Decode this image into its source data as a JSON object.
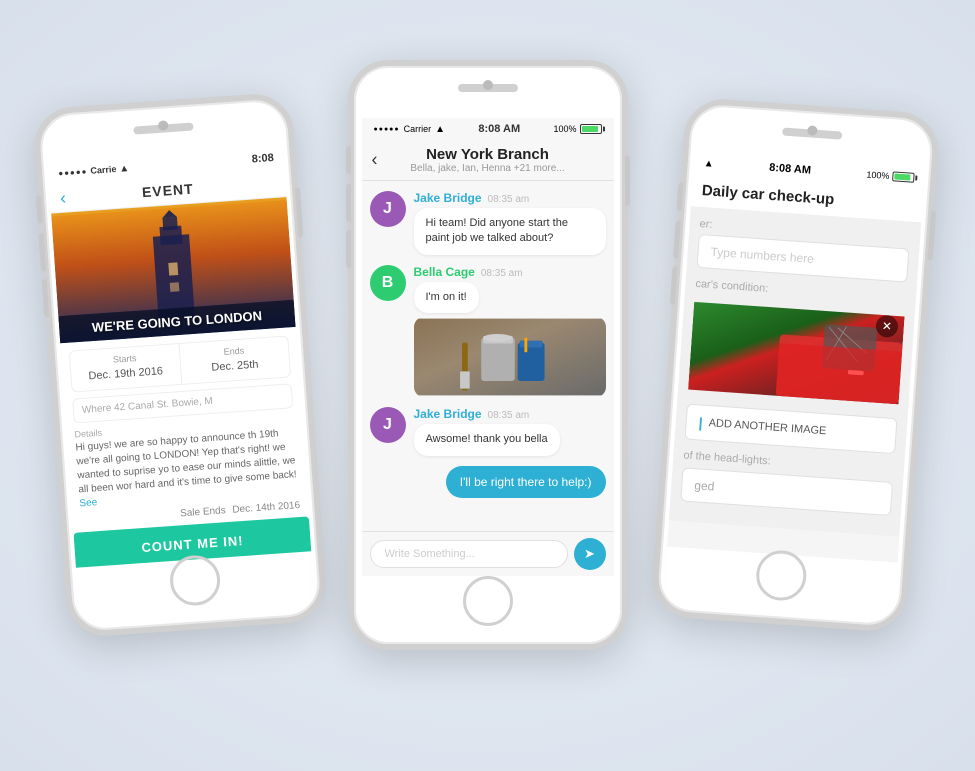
{
  "left_phone": {
    "status_bar": {
      "carrier": "Carrie",
      "signal": "●●●●●",
      "wifi": "wifi",
      "time": "8:08"
    },
    "header": {
      "back_label": "‹",
      "title": "EVENT"
    },
    "hero_text": "WE'RE GOING TO LONDON",
    "dates": {
      "starts_label": "Starts",
      "starts_value": "Dec. 19th 2016",
      "ends_label": "Ends",
      "ends_value": "Dec. 25th"
    },
    "where_label": "Where",
    "where_value": "42 Canal St. Bowie, M",
    "details_label": "Details",
    "details_text": "Hi guys! we are so happy to announce th 19th we're all going to LONDON! Yep that's right! we wanted to suprise yo to ease our minds alittle, we all been wor hard and it's time to give some back!",
    "see_more": "See",
    "sale_ends_label": "Sale Ends",
    "sale_ends_value": "Dec. 14th 2016",
    "cta_button": "COUNT ME IN!"
  },
  "center_phone": {
    "status_bar": {
      "carrier": "Carrier",
      "wifi": "wifi",
      "time": "8:08 AM",
      "battery": "100%"
    },
    "chat_title": "New York Branch",
    "chat_subtitle": "Bella, jake, Ian, Henna +21 more...",
    "back_label": "‹",
    "messages": [
      {
        "id": "msg1",
        "avatar_letter": "J",
        "avatar_color": "purple",
        "name": "Jake Bridge",
        "name_color": "blue",
        "time": "08:35 am",
        "text": "Hi team! Did anyone start the paint job we talked about?",
        "has_image": false
      },
      {
        "id": "msg2",
        "avatar_letter": "B",
        "avatar_color": "green",
        "name": "Bella Cage",
        "name_color": "green",
        "time": "08:35 am",
        "text": "I'm on it!",
        "has_image": true
      },
      {
        "id": "msg3",
        "avatar_letter": "J",
        "avatar_color": "purple",
        "name": "Jake Bridge",
        "name_color": "blue",
        "time": "08:35 am",
        "text": "Awsome! thank you bella",
        "has_image": false
      },
      {
        "id": "msg4_self",
        "text": "I'll be right there to help:)",
        "is_self": true
      }
    ],
    "input_placeholder": "Write Something...",
    "send_icon": "➤"
  },
  "right_phone": {
    "status_bar": {
      "wifi": "wifi",
      "time": "8:08 AM",
      "battery": "100%"
    },
    "form_title": "Daily car check-up",
    "field_label": "er:",
    "field_placeholder": "Type numbers here",
    "section_label": "car's condition:",
    "add_image_label": "ADD ANOTHER IMAGE",
    "section_label2": "of the head-lights:",
    "select_placeholder": "ged"
  }
}
